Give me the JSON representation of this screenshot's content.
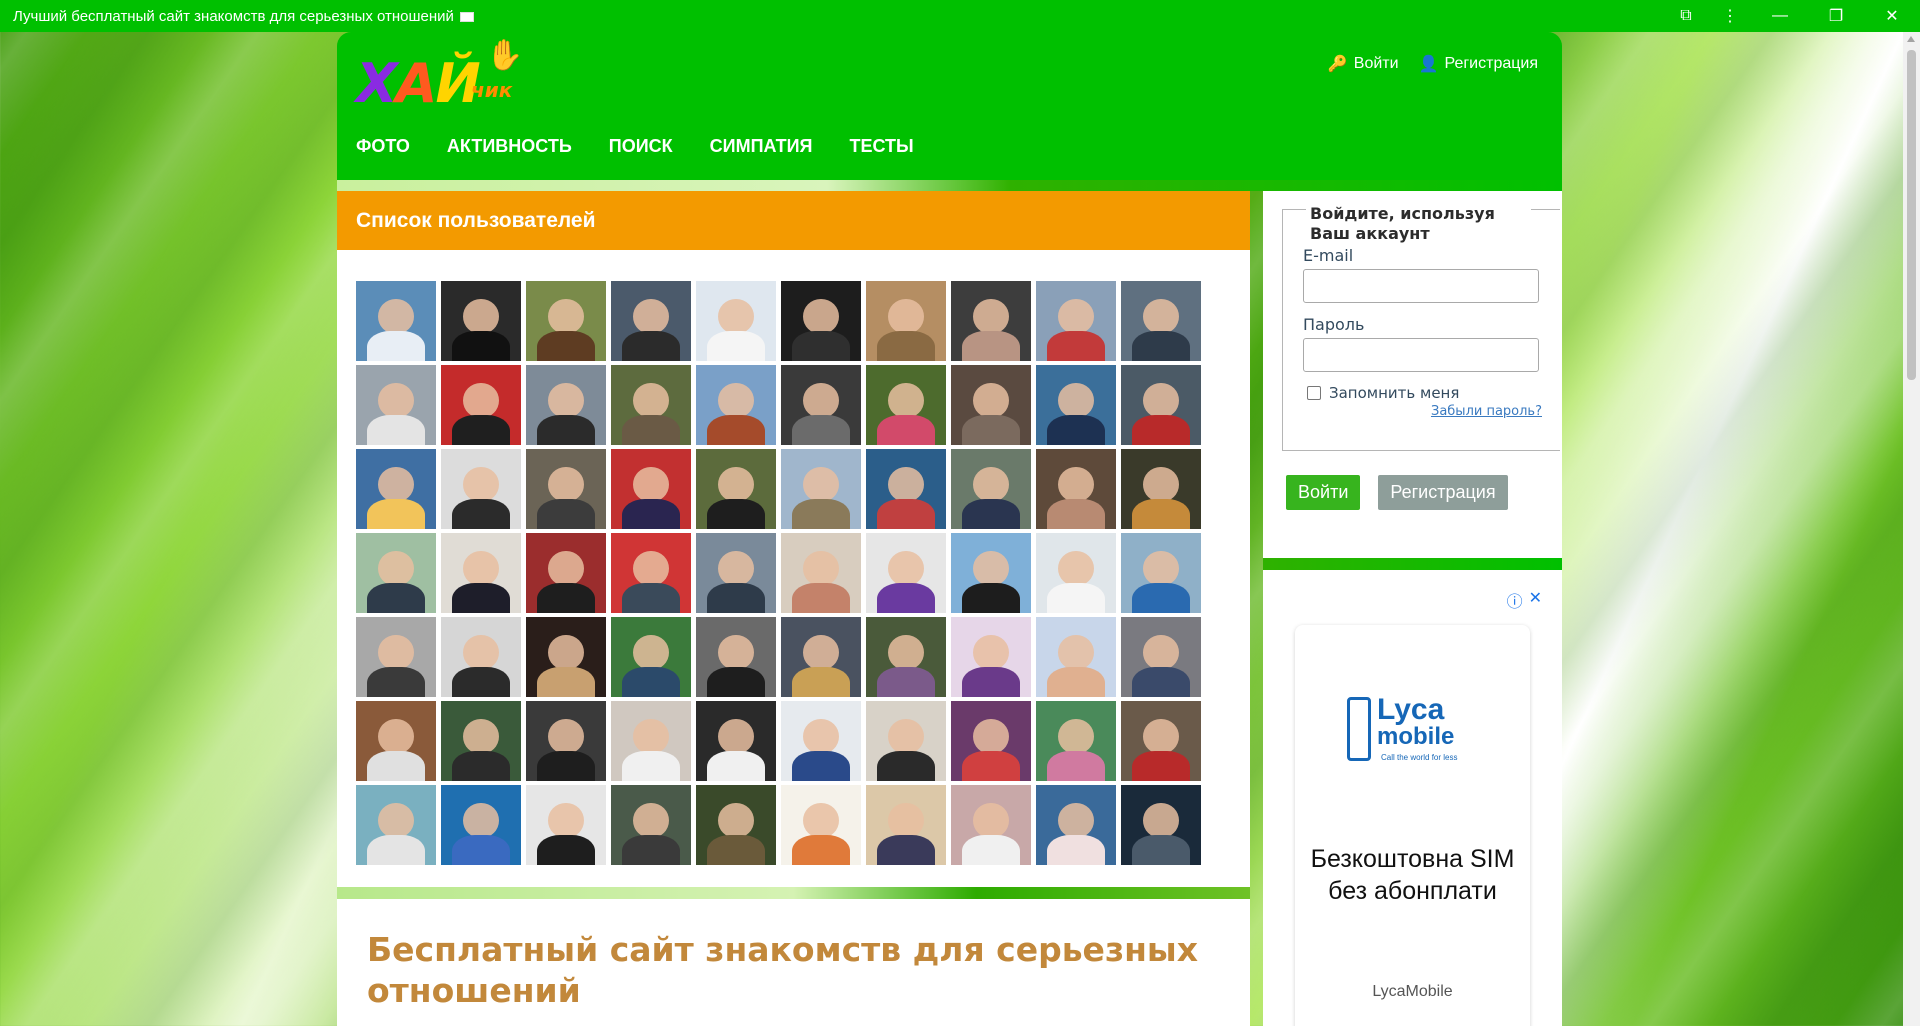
{
  "window": {
    "title": "Лучший бесплатный сайт знакомств для серьезных отношений",
    "buttons": {
      "extension": "⧉",
      "menu": "⋮",
      "minimize": "—",
      "restore": "❐",
      "close": "✕"
    }
  },
  "header": {
    "logo": {
      "part1": "Х",
      "part2": "А",
      "part3": "Й",
      "small": "чик"
    },
    "auth": {
      "login": "Войти",
      "register": "Регистрация"
    },
    "nav": [
      "ФОТО",
      "АКТИВНОСТЬ",
      "ПОИСК",
      "СИМПАТИЯ",
      "ТЕСТЫ"
    ]
  },
  "users_panel": {
    "title": "Список пользователей",
    "photos": [
      {
        "bg": "#5b8db8",
        "body": "#e8eef5"
      },
      {
        "bg": "#2a2a2a",
        "body": "#111"
      },
      {
        "bg": "#7a8b4a",
        "body": "#5e3c22"
      },
      {
        "bg": "#4b5a6b",
        "body": "#2b2b2b"
      },
      {
        "bg": "#dfe7ef",
        "body": "#f5f5f5"
      },
      {
        "bg": "#1d1d1d",
        "body": "#2f2f2f"
      },
      {
        "bg": "#b58e63",
        "body": "#8a6a43"
      },
      {
        "bg": "#3d3d3d",
        "body": "#b89483"
      },
      {
        "bg": "#8aa0b8",
        "body": "#c23a3a"
      },
      {
        "bg": "#5f7080",
        "body": "#2e3b4a"
      },
      {
        "bg": "#9aa4ad",
        "body": "#e4e4e4"
      },
      {
        "bg": "#c42b2b",
        "body": "#1f1f1f"
      },
      {
        "bg": "#7e8b98",
        "body": "#2b2b2b"
      },
      {
        "bg": "#5d6b3e",
        "body": "#6a5a45"
      },
      {
        "bg": "#7aa0c8",
        "body": "#a54b2b"
      },
      {
        "bg": "#3a3a3a",
        "body": "#6b6b6b"
      },
      {
        "bg": "#4d6b2d",
        "body": "#d24a6a"
      },
      {
        "bg": "#5a4a40",
        "body": "#7b6a5e"
      },
      {
        "bg": "#3b6f9a",
        "body": "#1d3152"
      },
      {
        "bg": "#4b5a66",
        "body": "#b82a2a"
      },
      {
        "bg": "#3f6fa3",
        "body": "#f2c45a"
      },
      {
        "bg": "#dcdcdc",
        "body": "#2b2b2b"
      },
      {
        "bg": "#6b6456",
        "body": "#3c3c3c"
      },
      {
        "bg": "#c23030",
        "body": "#2a2550"
      },
      {
        "bg": "#5c6b3c",
        "body": "#1e1e1e"
      },
      {
        "bg": "#a0b6cc",
        "body": "#8a7a5a"
      },
      {
        "bg": "#2b5e8a",
        "body": "#c04040"
      },
      {
        "bg": "#6a7a6a",
        "body": "#2a3550"
      },
      {
        "bg": "#5e4a3a",
        "body": "#b88a72"
      },
      {
        "bg": "#3a3a2a",
        "body": "#c58a3a"
      },
      {
        "bg": "#9fbfa2",
        "body": "#2e3b4a"
      },
      {
        "bg": "#e0dcd5",
        "body": "#1e1e2a"
      },
      {
        "bg": "#9b2d2d",
        "body": "#1e1e1e"
      },
      {
        "bg": "#d03535",
        "body": "#3a4a5a"
      },
      {
        "bg": "#7a8a9a",
        "body": "#2e3b4a"
      },
      {
        "bg": "#d8cdbf",
        "body": "#c4826a"
      },
      {
        "bg": "#e6e6e6",
        "body": "#6a3aa0"
      },
      {
        "bg": "#7fb0d8",
        "body": "#1d1d1d"
      },
      {
        "bg": "#e0e6ea",
        "body": "#f5f5f5"
      },
      {
        "bg": "#8fb0c8",
        "body": "#2a6ab0"
      },
      {
        "bg": "#a8a8a8",
        "body": "#3a3a3a"
      },
      {
        "bg": "#d6d6d6",
        "body": "#2b2b2b"
      },
      {
        "bg": "#2a1e1a",
        "body": "#c8a070"
      },
      {
        "bg": "#3b7a3b",
        "body": "#2b4a6a"
      },
      {
        "bg": "#6a6a6a",
        "body": "#1e1e1e"
      },
      {
        "bg": "#4a5260",
        "body": "#c9a055"
      },
      {
        "bg": "#4a5a3a",
        "body": "#7b5a8a"
      },
      {
        "bg": "#e6d6e8",
        "body": "#6a3a8a"
      },
      {
        "bg": "#c8d6ea",
        "body": "#e0b090"
      },
      {
        "bg": "#7a7a80",
        "body": "#3a4a6a"
      },
      {
        "bg": "#8a5a3a",
        "body": "#e0e0e0"
      },
      {
        "bg": "#3a5a3a",
        "body": "#2b2b2b"
      },
      {
        "bg": "#3a3a3a",
        "body": "#1e1e1e"
      },
      {
        "bg": "#d0c8c0",
        "body": "#f0f0f0"
      },
      {
        "bg": "#2a2a2a",
        "body": "#f0f0f0"
      },
      {
        "bg": "#e6eaee",
        "body": "#2a4a8a"
      },
      {
        "bg": "#d8d2c8",
        "body": "#2a2a2a"
      },
      {
        "bg": "#6a3a6a",
        "body": "#d04040"
      },
      {
        "bg": "#4a8a5a",
        "body": "#d07aa0"
      },
      {
        "bg": "#6a5a4a",
        "body": "#b82a2a"
      },
      {
        "bg": "#7ab0c0",
        "body": "#e4e4e4"
      },
      {
        "bg": "#1f6fb0",
        "body": "#3a6ac0"
      },
      {
        "bg": "#e6e6e6",
        "body": "#1e1e1e"
      },
      {
        "bg": "#4a5a4a",
        "body": "#3a3a3a"
      },
      {
        "bg": "#3a4a2a",
        "body": "#6a5a3a"
      },
      {
        "bg": "#f5f2ea",
        "body": "#e07a3a"
      },
      {
        "bg": "#dcc8a8",
        "body": "#3a3a5a"
      },
      {
        "bg": "#c8a8a8",
        "body": "#f0f0f0"
      },
      {
        "bg": "#3a6a9a",
        "body": "#f0e0e0"
      },
      {
        "bg": "#1a2a3a",
        "body": "#4a5a6a"
      }
    ]
  },
  "about": {
    "title": "Бесплатный сайт знакомств для серьезных отношений"
  },
  "login_form": {
    "legend": "Войдите, используя Ваш аккаунт",
    "email_label": "E-mail",
    "password_label": "Пароль",
    "remember": "Запомнить меня",
    "forgot": "Забыли пароль?",
    "login_button": "Войти",
    "register_button": "Регистрация"
  },
  "ad": {
    "brand_line1": "Lyca",
    "brand_line2": "mobile",
    "tagline": "Call the world for less",
    "text": "Безкоштовна SIM без абонплати",
    "advertiser": "LycaMobile"
  },
  "colors": {
    "brand_green": "#00c000",
    "panel_orange": "#f39a00",
    "title_gold": "#c2883b"
  }
}
